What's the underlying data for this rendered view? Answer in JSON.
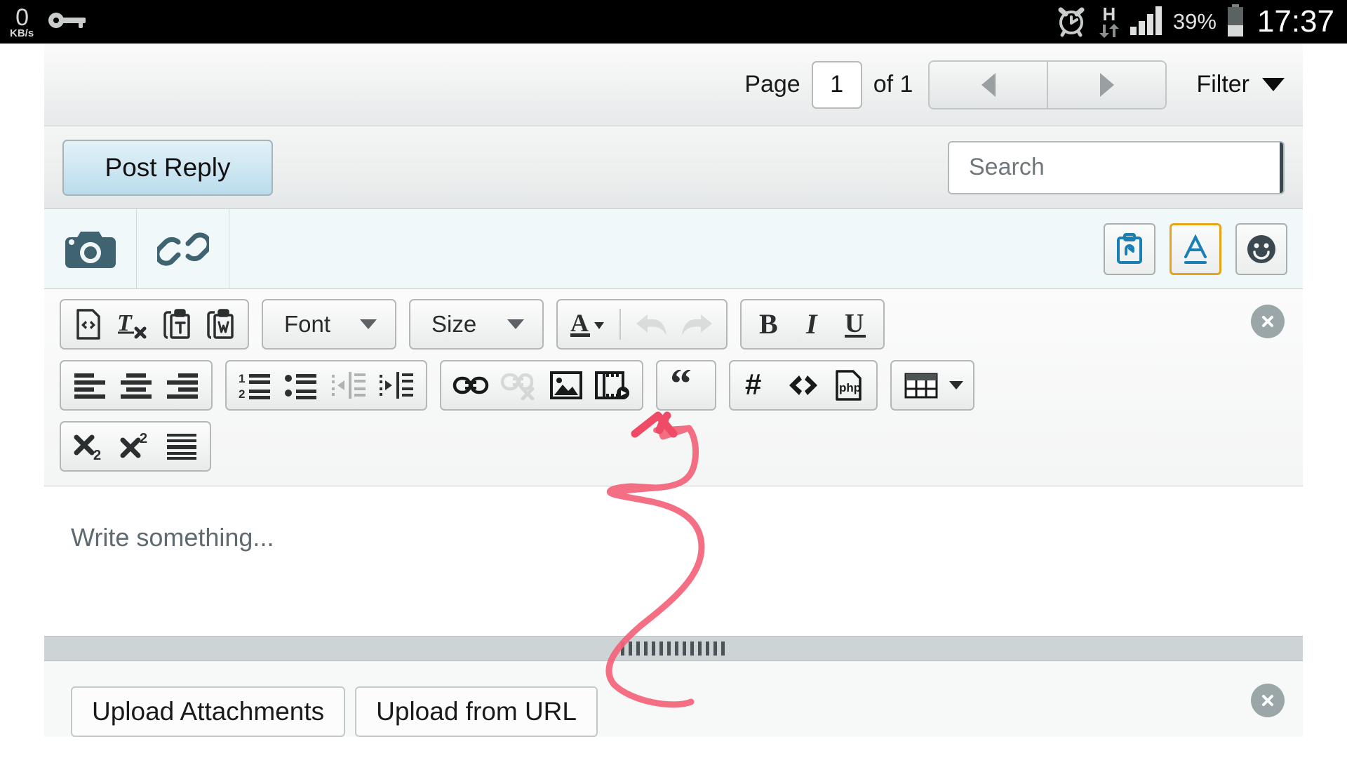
{
  "statusbar": {
    "net_speed_value": "0",
    "net_speed_unit": "KB/s",
    "key_icon": "vpn-key-icon",
    "alarm_icon": "alarm-clock-icon",
    "network_type": "H",
    "signal_icon": "signal-bars-icon",
    "battery_percent": "39%",
    "battery_icon": "battery-icon",
    "clock": "17:37"
  },
  "pagination": {
    "page_label": "Page",
    "page_value": "1",
    "of_label": "of 1",
    "prev_icon": "triangle-left-icon",
    "next_icon": "triangle-right-icon",
    "filter_label": "Filter",
    "filter_caret_icon": "chevron-down-icon"
  },
  "actionbar": {
    "post_reply_label": "Post Reply",
    "search_value": "",
    "search_placeholder": "Search",
    "search_icon": "search-icon"
  },
  "attachstrip": {
    "camera_icon": "camera-icon",
    "link_icon": "link-chain-icon",
    "right_buttons": [
      {
        "name": "paste-clipboard-icon",
        "active": false
      },
      {
        "name": "text-format-a-icon",
        "active": true
      },
      {
        "name": "emoji-smiley-icon",
        "active": false
      }
    ]
  },
  "editor_toolbar": {
    "close_icon": "close-circle-icon",
    "rows": [
      {
        "groups": [
          {
            "buttons": [
              {
                "icon": "source-code-document-icon",
                "disabled": false
              },
              {
                "icon": "remove-format-icon",
                "disabled": false
              },
              {
                "icon": "paste-as-text-icon",
                "disabled": false
              },
              {
                "icon": "paste-from-word-icon",
                "disabled": false
              }
            ]
          },
          {
            "type": "dropdown",
            "label": "Font",
            "icon": "font-family-dropdown"
          },
          {
            "type": "dropdown",
            "label": "Size",
            "icon": "font-size-dropdown"
          },
          {
            "buttons": [
              {
                "icon": "text-color-a-icon",
                "disabled": false
              },
              {
                "icon": "separator",
                "disabled": false
              },
              {
                "icon": "undo-arrow-icon",
                "disabled": true
              },
              {
                "icon": "redo-arrow-icon",
                "disabled": true
              }
            ]
          },
          {
            "buttons": [
              {
                "icon": "bold-icon",
                "disabled": false
              },
              {
                "icon": "italic-icon",
                "disabled": false
              },
              {
                "icon": "underline-icon",
                "disabled": false
              }
            ]
          }
        ]
      },
      {
        "groups": [
          {
            "buttons": [
              {
                "icon": "align-left-icon",
                "disabled": false
              },
              {
                "icon": "align-center-icon",
                "disabled": false
              },
              {
                "icon": "align-right-icon",
                "disabled": false
              }
            ]
          },
          {
            "buttons": [
              {
                "icon": "numbered-list-icon",
                "disabled": false
              },
              {
                "icon": "bulleted-list-icon",
                "disabled": false
              },
              {
                "icon": "outdent-icon",
                "disabled": true
              },
              {
                "icon": "indent-icon",
                "disabled": false
              }
            ]
          },
          {
            "buttons": [
              {
                "icon": "insert-link-icon",
                "disabled": false
              },
              {
                "icon": "unlink-icon",
                "disabled": true
              },
              {
                "icon": "insert-image-icon",
                "disabled": false
              },
              {
                "icon": "insert-video-icon",
                "disabled": false
              }
            ]
          },
          {
            "buttons": [
              {
                "icon": "blockquote-icon",
                "disabled": false
              }
            ]
          },
          {
            "buttons": [
              {
                "icon": "hash-code-icon",
                "disabled": false
              },
              {
                "icon": "inline-code-icon",
                "disabled": false
              },
              {
                "icon": "php-code-icon",
                "disabled": false
              }
            ]
          },
          {
            "buttons": [
              {
                "icon": "insert-table-icon",
                "disabled": false
              },
              {
                "icon": "table-caret-icon",
                "disabled": false
              }
            ]
          }
        ]
      },
      {
        "groups": [
          {
            "buttons": [
              {
                "icon": "subscript-icon",
                "disabled": false
              },
              {
                "icon": "superscript-icon",
                "disabled": false
              },
              {
                "icon": "justify-icon",
                "disabled": false
              }
            ]
          }
        ]
      }
    ]
  },
  "write_area": {
    "placeholder": "Write something...",
    "value": "",
    "resize_handle_icon": "resize-grippy-icon"
  },
  "upload": {
    "close_icon": "close-circle-icon",
    "buttons": [
      {
        "label": "Upload Attachments"
      },
      {
        "label": "Upload from URL"
      }
    ]
  },
  "annotation": {
    "type": "hand-drawn-arrow",
    "color": "#f4637a",
    "points_to": "insert-image-icon"
  },
  "colors": {
    "status_bar_bg": "#000000",
    "accent_blue": "#1a7fb5",
    "active_border": "#e8a317",
    "annotation_pink": "#f4637a",
    "search_button_bg": "#3c4850",
    "post_reply_bg": "#cfe7f2"
  }
}
